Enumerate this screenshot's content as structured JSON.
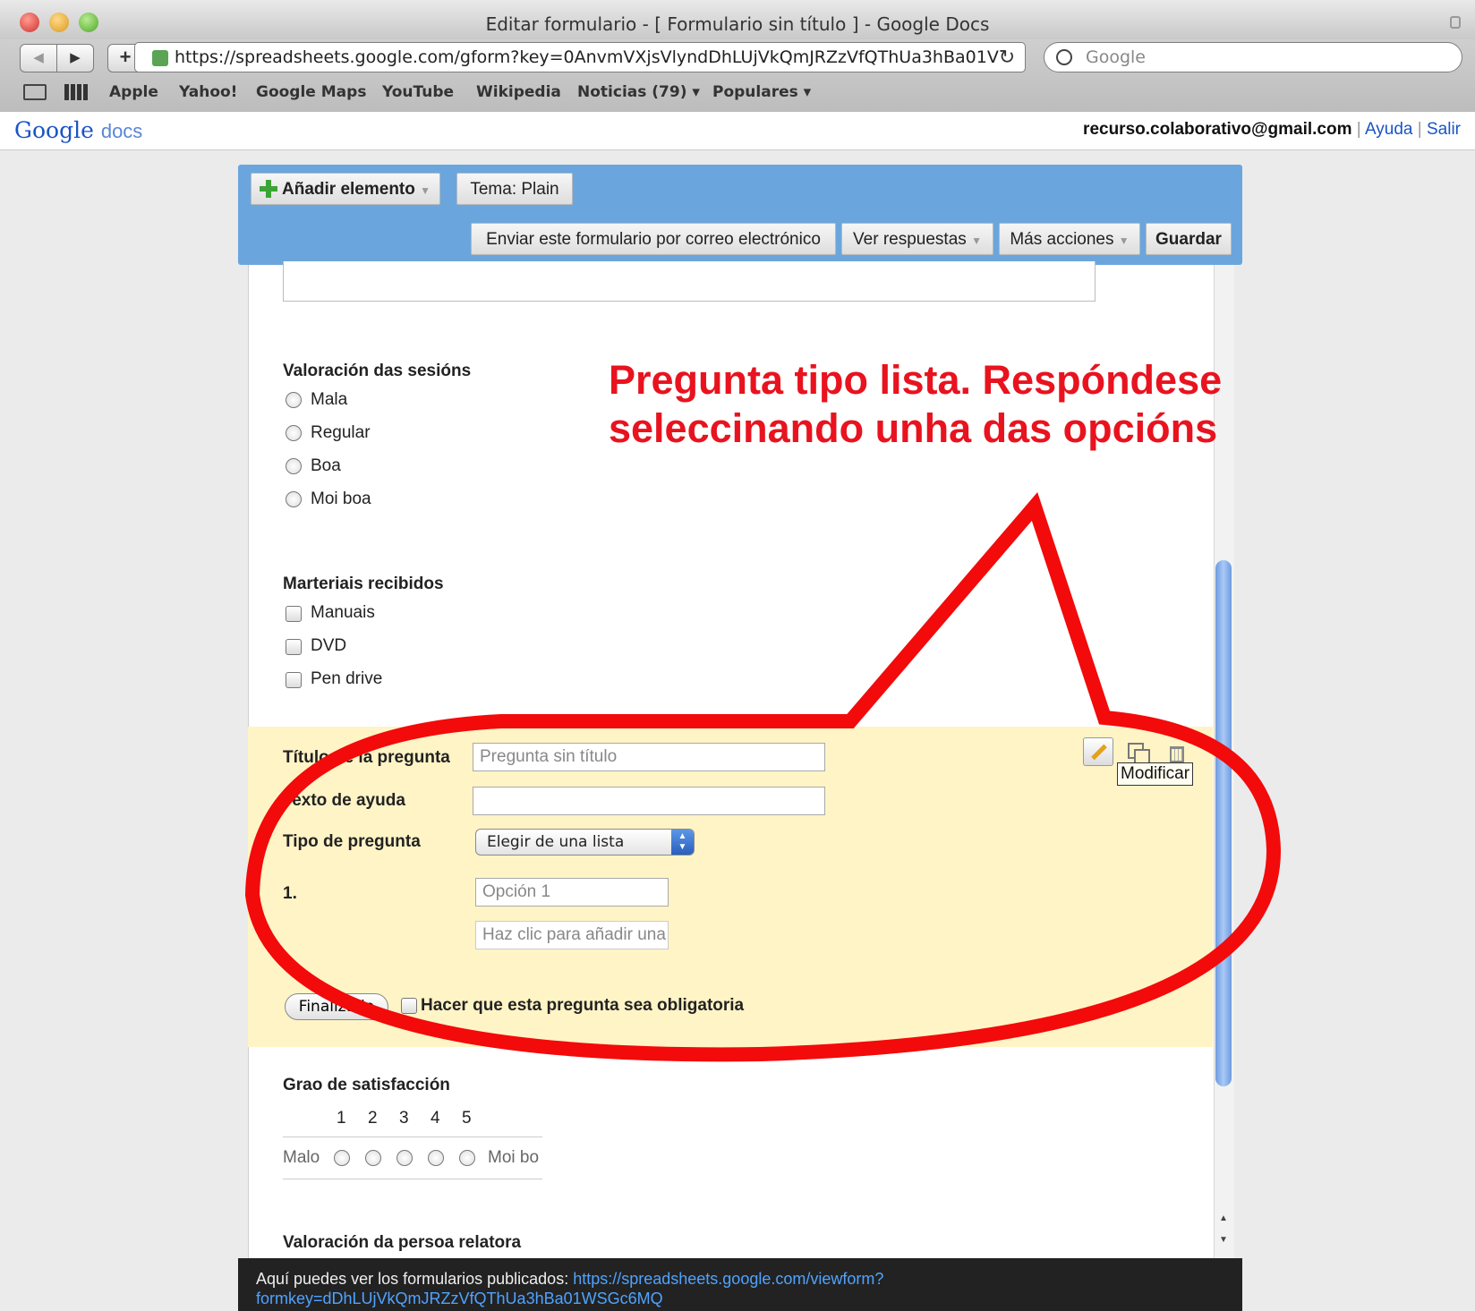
{
  "window": {
    "title": "Editar formulario - [ Formulario sin título ] - Google Docs"
  },
  "browser": {
    "url": "https://spreadsheets.google.com/gform?key=0AnvmVXjsVlyndDhLUjVkQmJRZzVfQThUa3hBa01V",
    "search_placeholder": "Google",
    "back_glyph": "◀",
    "forward_glyph": "▶",
    "add_glyph": "+",
    "reload_glyph": "↻",
    "bookmarks": [
      "Apple",
      "Yahoo!",
      "Google Maps",
      "YouTube",
      "Wikipedia",
      "Noticias (79) ▾",
      "Populares ▾"
    ]
  },
  "docs_header": {
    "logo_google": "Google",
    "logo_docs": "docs",
    "account": "recurso.colaborativo@gmail.com",
    "separator": "|",
    "help": "Ayuda",
    "logout": "Salir"
  },
  "form_toolbar": {
    "add_item": "Añadir elemento",
    "theme": "Tema:  Plain",
    "email_form": "Enviar este formulario por correo electrónico",
    "see_responses": "Ver respuestas",
    "more_actions": "Más acciones",
    "save": "Guardar"
  },
  "questions": {
    "q1": {
      "title": "Valoración das sesións",
      "options": [
        "Mala",
        "Regular",
        "Boa",
        "Moi boa"
      ]
    },
    "q2": {
      "title": "Marteriais recibidos",
      "options": [
        "Manuais",
        "DVD",
        "Pen drive"
      ]
    },
    "q4": {
      "title": "Grao de satisfacción",
      "scale": [
        "1",
        "2",
        "3",
        "4",
        "5"
      ],
      "low_label": "Malo",
      "high_label": "Moi bo"
    },
    "q5": {
      "title": "Valoración da persoa relatora"
    }
  },
  "editor": {
    "title_label": "Título de la pregunta",
    "title_placeholder": "Pregunta sin título",
    "help_label": "Texto de ayuda",
    "type_label": "Tipo de pregunta",
    "type_value": "Elegir de una lista",
    "option_number": "1.",
    "option1_placeholder": "Opción 1",
    "add_option_placeholder": "Haz clic para añadir una opción",
    "done_button": "Finalizado",
    "required_label": "Hacer que esta pregunta sea obligatoria",
    "tooltip": "Modificar"
  },
  "annotation": {
    "line1": "Pregunta tipo lista. Respóndese",
    "line2": "seleccinando unha das opcións",
    "color": "#e8131f"
  },
  "banner": {
    "text": "Aquí puedes ver los formularios publicados: ",
    "link1": "https://spreadsheets.google.com/viewform?",
    "link2": "formkey=dDhLUjVkQmJRZzVfQThUa3hBa01WSGc6MQ"
  },
  "colors": {
    "toolbar_blue": "#6aa6dd",
    "editor_bg": "#fff4c6",
    "annotation_red": "#e8131f"
  }
}
